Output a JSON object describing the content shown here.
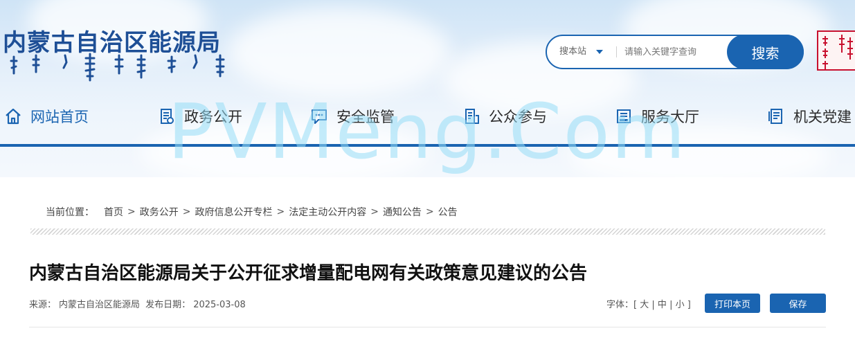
{
  "header": {
    "site_title": "内蒙古自治区能源局",
    "search": {
      "scope_label": "搜本站",
      "placeholder": "请输入关键字查询",
      "button_label": "搜索"
    }
  },
  "nav": {
    "items": [
      {
        "label": "网站首页",
        "icon": "home-icon"
      },
      {
        "label": "政务公开",
        "icon": "document-icon"
      },
      {
        "label": "安全监管",
        "icon": "chat-icon"
      },
      {
        "label": "公众参与",
        "icon": "clipboard-icon"
      },
      {
        "label": "服务大厅",
        "icon": "service-icon"
      },
      {
        "label": "机关党建",
        "icon": "book-icon"
      }
    ]
  },
  "watermark": "PVMeng.Com",
  "breadcrumb": {
    "label": "当前位置：",
    "items": [
      "首页",
      "政务公开",
      "政府信息公开专栏",
      "法定主动公开内容",
      "通知公告",
      "公告"
    ],
    "separator": ">"
  },
  "article": {
    "title": "内蒙古自治区能源局关于公开征求增量配电网有关政策意见建议的公告",
    "source_label": "来源：",
    "source": "内蒙古自治区能源局",
    "date_label": "发布日期：",
    "date": "2025-03-08"
  },
  "toolbar": {
    "font_label": "字体：",
    "bracket_open": "[",
    "bracket_close": "]",
    "divider": "|",
    "font_large": "大",
    "font_medium": "中",
    "font_small": "小",
    "print_label": "打印本页",
    "save_label": "保存"
  },
  "colors": {
    "accent": "#1a64b1",
    "title": "#1e4f96",
    "seal": "#c8102e"
  }
}
